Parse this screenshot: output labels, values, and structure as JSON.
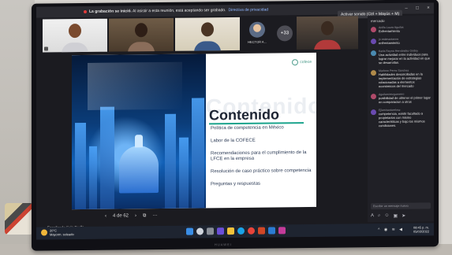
{
  "meeting": {
    "recording_banner_lead": "La grabación se inició.",
    "recording_banner_text": "Al asistir a esta reunión, está aceptando ser grabado.",
    "privacy_link": "Directiva de privacidad",
    "tooltip": "Activar sonido (Ctrl + Mayús + M)",
    "participant_name": "HECTOR A...",
    "overflow_count": "+33"
  },
  "slide": {
    "watermark": "Contenido",
    "title": "Contenido",
    "logo_text": "cofece",
    "toc": [
      "Política de competencia en México",
      "Labor de la COFECE",
      "Recomendaciones para el cumplimiento de la LFCE en la empresa",
      "Resolución de caso práctico sobre competencia",
      "Preguntas y respuestas"
    ]
  },
  "slide_nav": {
    "prev": "‹",
    "page": "4 de 62",
    "next": "›",
    "more": "···"
  },
  "presenter_note": "Enseñando Sala Zoolle",
  "chat": {
    "top_text": "mercado",
    "messages": [
      {
        "meta": "Anilla Laura Aguilas",
        "text": "Enfrentamiento"
      },
      {
        "meta": "jo estimantanos",
        "text": "enfrentamiento"
      },
      {
        "meta": "Karla Reyna Hernández Godoy",
        "text": "Una actividad entre individuos para lograr mejorar en la actividad en que se desarrollan."
      },
      {
        "meta": "Marlene Perez Sánchez",
        "text": "Habilidades desarrolladas en la implementación de estrategias relacionadas a elementos económicos del mercado"
      },
      {
        "meta": "Aguilamirezguerrero",
        "text": "posibilidad de obtener el primer lugar en comparacion a otros"
      },
      {
        "meta": "Ejlamirantarelosz",
        "text": "competencia, existir facultado a propietarios con mismo características y bajo los mismos condiciones."
      }
    ],
    "input_placeholder": "Escribir un mensaje nuevo"
  },
  "taskbar": {
    "weather_temp": "20°C",
    "weather_desc": "Mayorm. soleado",
    "time": "08:45 p. m.",
    "date": "05/03/2022"
  },
  "brand": "HUAWEI"
}
